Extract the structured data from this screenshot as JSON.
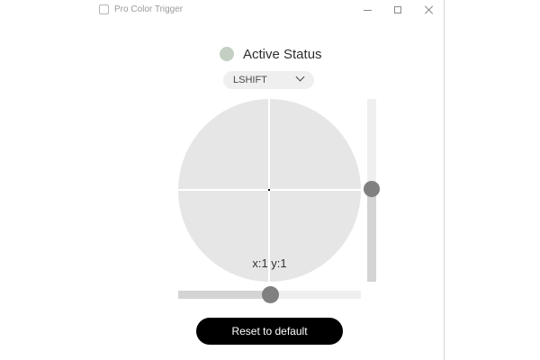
{
  "window": {
    "title": "Pro Color Trigger",
    "icon": "app-square-icon"
  },
  "title_buttons": {
    "minimize_icon": "minimize-icon",
    "maximize_icon": "maximize-icon",
    "close_icon": "close-icon"
  },
  "status": {
    "label": "Active Status",
    "indicator_color": "#c3cfc3"
  },
  "key_select": {
    "value": "LSHIFT",
    "icon": "chevron-down-icon"
  },
  "pad": {
    "coords_text": "x:1 y:1",
    "background_color": "#e6e6e6"
  },
  "vertical_slider": {
    "level_fraction": 0.5
  },
  "horizontal_slider": {
    "level_fraction": 0.5
  },
  "reset": {
    "label": "Reset to default",
    "background_color": "#000000"
  }
}
